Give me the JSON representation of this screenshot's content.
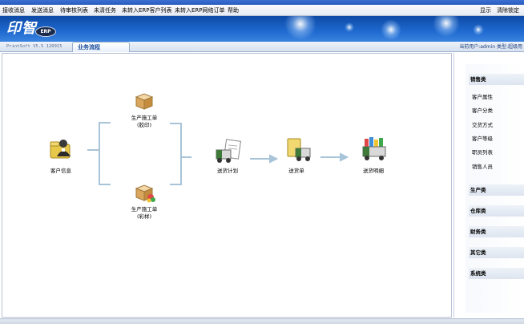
{
  "window": {
    "title": ""
  },
  "menu": {
    "items": [
      "接收消息",
      "发送消息",
      "待审核列表",
      "未清任务",
      "未转入ERP客户列表",
      "未转入ERP网络订单",
      "帮助"
    ],
    "right_items": [
      "显示",
      "清除锁定"
    ]
  },
  "banner": {
    "logo_text": "印智",
    "logo_badge": "ERP"
  },
  "toolbar": {
    "version": "PrintSoft V5.5 120915",
    "active_tab": "业务流程",
    "user_info": "当前用户:admin 类型:超级用"
  },
  "flow": {
    "customer": "客户信息",
    "work_order_print_line1": "生产施工单",
    "work_order_print_line2": "(胶印)",
    "work_order_digital_line1": "生产施工单",
    "work_order_digital_line2": "(彩样)",
    "delivery_plan": "送货计划",
    "delivery_note": "送货单",
    "delivery_detail": "送货明细"
  },
  "right_panel": {
    "sales": {
      "header": "销售类",
      "items": [
        "客户属性",
        "客户分类",
        "交货方式",
        "客户等级",
        "职员列表",
        "销售人员"
      ]
    },
    "production": {
      "header": "生产类"
    },
    "warehouse": {
      "header": "仓库类"
    },
    "finance": {
      "header": "财务类"
    },
    "other": {
      "header": "其它类"
    },
    "system": {
      "header": "系统类"
    }
  },
  "colors": {
    "banner": "#1f6ad0",
    "connector": "#a8c4d8",
    "truck_green": "#3f7a3a",
    "folder_yellow": "#e8c84a"
  }
}
